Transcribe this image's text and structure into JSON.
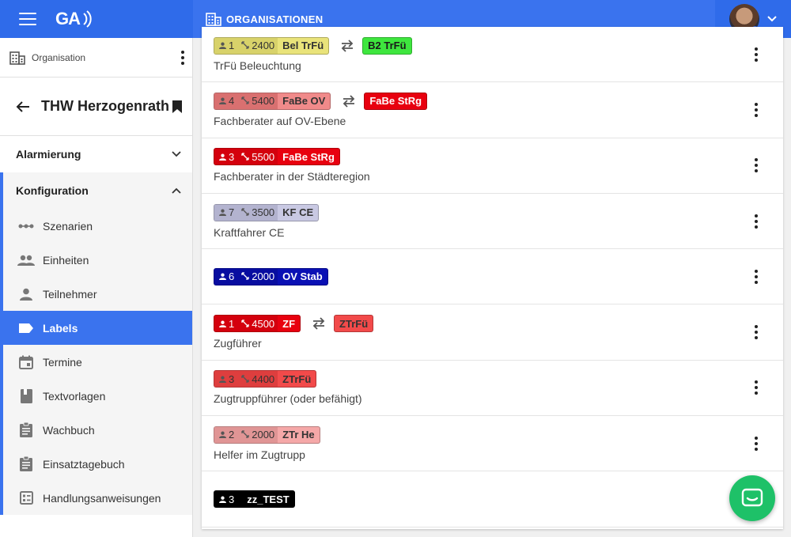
{
  "header": {
    "logo_text": "GA",
    "page_title": "ORGANISATIONEN",
    "accent": "#3a73ee"
  },
  "sidebar": {
    "org_label": "Organisation",
    "unit_name": "THW Herzogenrath",
    "sections": [
      {
        "label": "Alarmierung",
        "expanded": false
      },
      {
        "label": "Konfiguration",
        "expanded": true
      }
    ],
    "items": [
      {
        "label": "Szenarien",
        "icon": "scenario-icon"
      },
      {
        "label": "Einheiten",
        "icon": "group-icon"
      },
      {
        "label": "Teilnehmer",
        "icon": "person-icon"
      },
      {
        "label": "Labels",
        "icon": "label-icon",
        "active": true
      },
      {
        "label": "Termine",
        "icon": "calendar-icon"
      },
      {
        "label": "Textvorlagen",
        "icon": "book-icon"
      },
      {
        "label": "Wachbuch",
        "icon": "clipboard-icon"
      },
      {
        "label": "Einsatztagebuch",
        "icon": "clipboard-icon"
      },
      {
        "label": "Handlungsanweisungen",
        "icon": "checklist-icon"
      }
    ]
  },
  "labels": [
    {
      "count": "1",
      "prio": "2400",
      "code": "Bel TrFü",
      "desc": "TrFü Beleuchtung",
      "bg": "#e9e37a",
      "metaBg": "#d8d26a",
      "fg": "#333333",
      "target": "B2 TrFü",
      "targetBg": "#3ee63e",
      "targetFg": "#1a1a1a"
    },
    {
      "count": "4",
      "prio": "5400",
      "code": "FaBe OV",
      "desc": "Fachberater auf OV-Ebene",
      "bg": "#f08a8a",
      "metaBg": "#d97070",
      "fg": "#333333",
      "target": "FaBe StRg",
      "targetBg": "#e8000f",
      "targetFg": "#ffffff"
    },
    {
      "count": "3",
      "prio": "5500",
      "code": "FaBe StRg",
      "desc": "Fachberater in der Städteregion",
      "bg": "#e8000f",
      "metaBg": "#d4000d",
      "fg": "#ffffff",
      "target": "",
      "targetBg": "",
      "targetFg": ""
    },
    {
      "count": "7",
      "prio": "3500",
      "code": "KF CE",
      "desc": "Kraftfahrer CE",
      "bg": "#c9c9e3",
      "metaBg": "#b3b3cf",
      "fg": "#333333",
      "target": "",
      "targetBg": "",
      "targetFg": ""
    },
    {
      "count": "6",
      "prio": "2000",
      "code": "OV Stab",
      "desc": "",
      "bg": "#0a10b4",
      "metaBg": "#080da0",
      "fg": "#ffffff",
      "target": "",
      "targetBg": "",
      "targetFg": ""
    },
    {
      "count": "1",
      "prio": "4500",
      "code": "ZF",
      "desc": "Zugführer",
      "bg": "#e8000f",
      "metaBg": "#d4000d",
      "fg": "#ffffff",
      "target": "ZTrFü",
      "targetBg": "#f24a4a",
      "targetFg": "#333333"
    },
    {
      "count": "3",
      "prio": "4400",
      "code": "ZTrFü",
      "desc": "Zugtruppführer (oder befähigt)",
      "bg": "#f24a4a",
      "metaBg": "#de3e3e",
      "fg": "#333333",
      "target": "",
      "targetBg": "",
      "targetFg": ""
    },
    {
      "count": "2",
      "prio": "2000",
      "code": "ZTr He",
      "desc": "Helfer im Zugtrupp",
      "bg": "#f5a8a8",
      "metaBg": "#e09595",
      "fg": "#333333",
      "target": "",
      "targetBg": "",
      "targetFg": ""
    },
    {
      "count": "3",
      "prio": "",
      "code": "zz_TEST",
      "desc": "",
      "bg": "#000000",
      "metaBg": "#000000",
      "fg": "#ffffff",
      "target": "",
      "targetBg": "",
      "targetFg": ""
    }
  ]
}
